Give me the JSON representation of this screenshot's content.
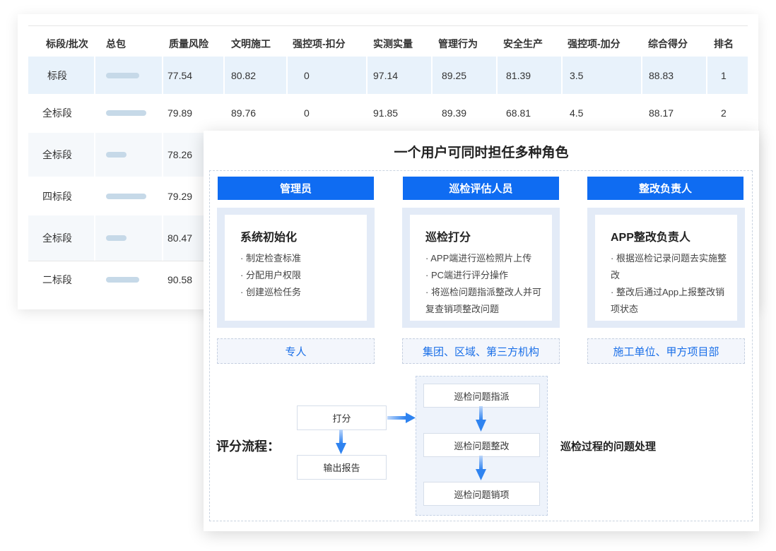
{
  "table": {
    "headers": [
      "标段/批次",
      "总包",
      "质量风险",
      "文明施工",
      "强控项-扣分",
      "实测实量",
      "管理行为",
      "安全生产",
      "强控项-加分",
      "综合得分",
      "排名"
    ],
    "rows": [
      {
        "name": "标段",
        "q": "77.54",
        "w": "80.82",
        "k": "0",
        "s": "97.14",
        "g": "89.25",
        "a": "81.39",
        "j": "3.5",
        "z": "88.83",
        "r": "1"
      },
      {
        "name": "全标段",
        "q": "79.89",
        "w": "89.76",
        "k": "0",
        "s": "91.85",
        "g": "89.39",
        "a": "68.81",
        "j": "4.5",
        "z": "88.17",
        "r": "2"
      },
      {
        "name": "全标段",
        "q": "78.26"
      },
      {
        "name": "四标段",
        "q": "79.29"
      },
      {
        "name": "全标段",
        "q": "80.47"
      },
      {
        "name": "二标段",
        "q": "90.58"
      }
    ]
  },
  "panel": {
    "title": "一个用户可同时担任多种角色",
    "roles": [
      {
        "head": "管理员",
        "sub": "系统初始化",
        "items": [
          "· 制定检查标准",
          "· 分配用户权限",
          "· 创建巡检任务"
        ],
        "tag": "专人"
      },
      {
        "head": "巡检评估人员",
        "sub": "巡检打分",
        "items": [
          "· APP端进行巡检照片上传",
          "· PC端进行评分操作",
          "· 将巡检问题指派整改人并可复查销项整改问题"
        ],
        "tag": "集团、区域、第三方机构"
      },
      {
        "head": "整改负责人",
        "sub": "APP整改负责人",
        "items": [
          "· 根据巡检记录问题去实施整改",
          "· 整改后通过App上报整改销项状态"
        ],
        "tag": "施工单位、甲方项目部"
      }
    ],
    "flow": {
      "label": "评分流程：",
      "score": "打分",
      "report": "输出报告",
      "issues": [
        "巡检问题指派",
        "巡检问题整改",
        "巡检问题销项"
      ],
      "issues_label": "巡检过程的问题处理"
    }
  },
  "colors": {
    "accent": "#0f6cf2",
    "role_bg": "#e3ebf7",
    "row_highlight": "#e8f2fb",
    "arrow": "#2f83f0"
  }
}
